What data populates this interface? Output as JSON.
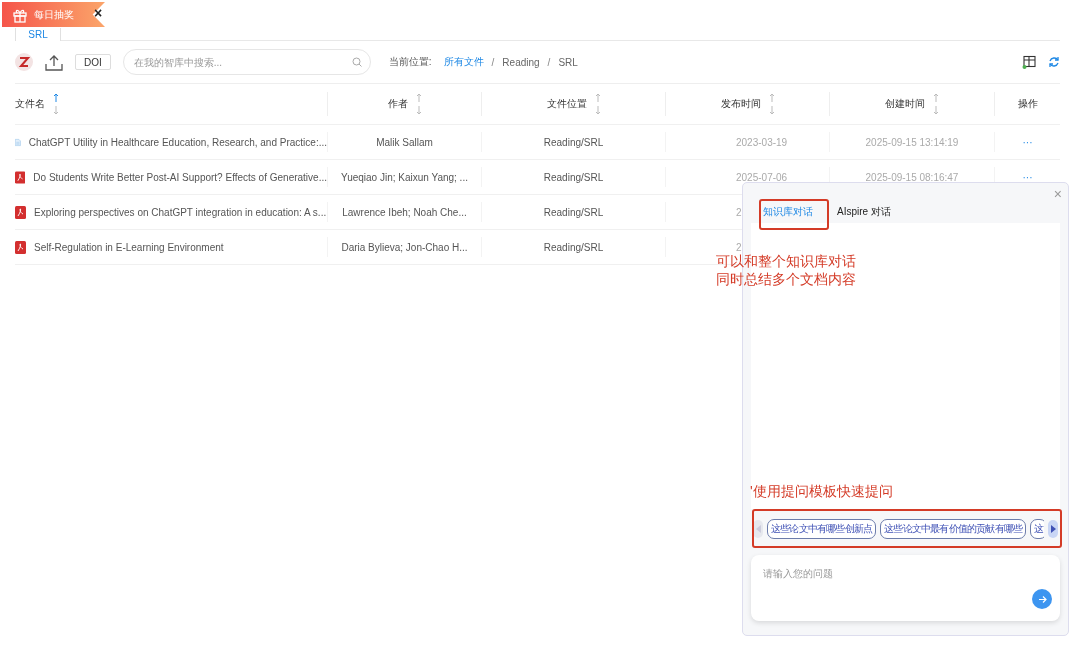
{
  "banner": {
    "label": "每日抽奖",
    "close": "×"
  },
  "tabs": [
    {
      "label": "SRL",
      "selected": true
    }
  ],
  "toolbar": {
    "doi": "DOI",
    "search": {
      "placeholder": "在我的智库中搜索..."
    },
    "breadcrumb_label": "当前位置:",
    "breadcrumb_separator": "/",
    "breadcrumb": [
      {
        "label": "所有文件",
        "link": true
      },
      {
        "label": "Reading",
        "link": false
      },
      {
        "label": "SRL",
        "link": false
      }
    ]
  },
  "table": {
    "columns": [
      {
        "label": "文件名",
        "kind": "sortable",
        "sort_active": true
      },
      {
        "label": "作者",
        "kind": "sortable",
        "sort_active": false
      },
      {
        "label": "文件位置",
        "kind": "sortable",
        "sort_active": false
      },
      {
        "label": "发布时间",
        "kind": "sortable",
        "sort_active": false
      },
      {
        "label": "创建时间",
        "kind": "sortable",
        "sort_active": false
      },
      {
        "label": "操作",
        "kind": "plain"
      }
    ],
    "rows": [
      {
        "kind": "doc",
        "name": "ChatGPT Utility in Healthcare Education, Research, and Practice:...",
        "author": "Malik Sallam",
        "location": "Reading/SRL",
        "published": "2023-03-19",
        "created": "2025-09-15 13:14:19",
        "actions": "···"
      },
      {
        "kind": "pdf",
        "name": "Do Students Write Better Post-AI Support? Effects of Generative...",
        "author": "Yueqiao Jin; Kaixun Yang; ...",
        "location": "Reading/SRL",
        "published": "2025-07-06",
        "created": "2025-09-15 08:16:47",
        "actions": "···"
      },
      {
        "kind": "pdf",
        "name": "Exploring perspectives on ChatGPT integration in education: A s...",
        "author": "Lawrence Ibeh; Noah Che...",
        "location": "Reading/SRL",
        "published": "2"
      },
      {
        "kind": "pdf",
        "name": "Self-Regulation in E-Learning Environment",
        "author": "Daria Bylieva; Jon-Chao H...",
        "location": "Reading/SRL",
        "published": "2"
      }
    ]
  },
  "chat_panel": {
    "close": "×",
    "tabs": [
      {
        "label": "知识库对话",
        "selected": true
      },
      {
        "label": "AIspire 对话",
        "selected": false
      }
    ],
    "templates": [
      "这些论文中有哪些创新点",
      "这些论文中最有价值的贡献有哪些",
      "这"
    ],
    "input": {
      "placeholder": "请输入您的问题"
    }
  },
  "annotations": [
    {
      "text": "可以和整个知识库对话"
    },
    {
      "text": "同时总结多个文档内容"
    },
    {
      "text": "'使用提问模板快速提问"
    }
  ]
}
